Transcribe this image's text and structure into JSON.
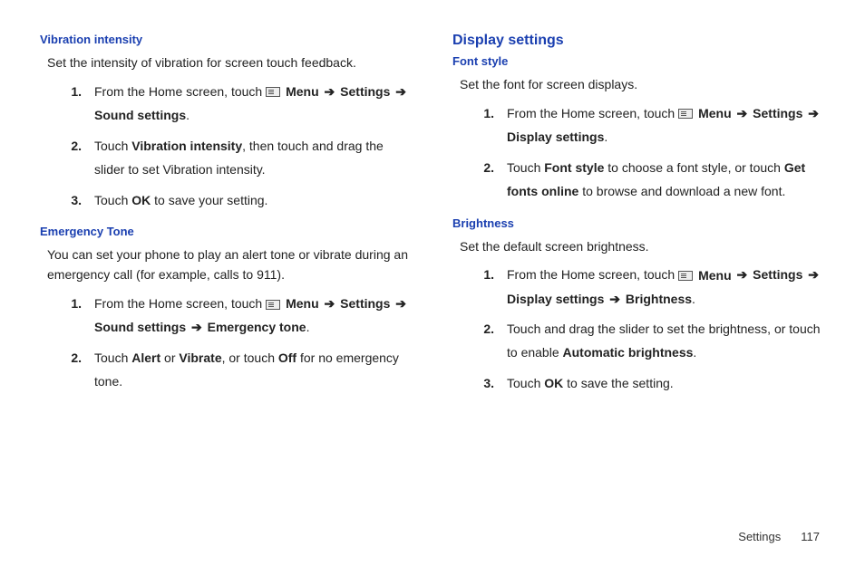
{
  "left": {
    "vibration": {
      "heading": "Vibration intensity",
      "intro": "Set the intensity of vibration for screen touch feedback.",
      "steps": [
        {
          "num": "1.",
          "pre": "From the Home screen, touch ",
          "menu_label": "Menu",
          "path1": "Settings",
          "path2": "Sound settings",
          "post": "."
        },
        {
          "num": "2.",
          "pre": "Touch ",
          "b1": "Vibration intensity",
          "post": ", then touch and drag the slider to set Vibration intensity."
        },
        {
          "num": "3.",
          "pre": "Touch ",
          "b1": "OK",
          "post": " to save your setting."
        }
      ]
    },
    "emergency": {
      "heading": "Emergency Tone",
      "intro": "You can set your phone to play an alert tone or vibrate during an emergency call (for example, calls to 911).",
      "steps": [
        {
          "num": "1.",
          "pre": "From the Home screen, touch ",
          "menu_label": "Menu",
          "path1": "Settings",
          "path2": "Sound settings",
          "path3": "Emergency tone",
          "post": "."
        },
        {
          "num": "2.",
          "pre": "Touch ",
          "b1": "Alert",
          "mid1": " or ",
          "b2": "Vibrate",
          "mid2": ", or touch ",
          "b3": "Off",
          "post": " for no emergency tone."
        }
      ]
    }
  },
  "right": {
    "display_heading": "Display settings",
    "fontstyle": {
      "heading": "Font style",
      "intro": "Set the font for screen displays.",
      "steps": [
        {
          "num": "1.",
          "pre": "From the Home screen, touch ",
          "menu_label": "Menu",
          "path1": "Settings",
          "path2": "Display settings",
          "post": "."
        },
        {
          "num": "2.",
          "pre": "Touch ",
          "b1": "Font style",
          "mid1": " to choose a font style, or touch ",
          "b2": "Get fonts online",
          "post": " to browse and download a new font."
        }
      ]
    },
    "brightness": {
      "heading": "Brightness",
      "intro": "Set the default screen brightness.",
      "steps": [
        {
          "num": "1.",
          "pre": "From the Home screen, touch ",
          "menu_label": "Menu",
          "path1": "Settings",
          "path2": "Display settings",
          "path3": "Brightness",
          "post": "."
        },
        {
          "num": "2.",
          "pre": "Touch and drag the slider to set the brightness, or touch to enable ",
          "b1": "Automatic brightness",
          "post": "."
        },
        {
          "num": "3.",
          "pre": "Touch ",
          "b1": "OK",
          "post": " to save the setting."
        }
      ]
    }
  },
  "footer": {
    "section": "Settings",
    "page": "117"
  },
  "glyphs": {
    "arrow": "➔"
  }
}
